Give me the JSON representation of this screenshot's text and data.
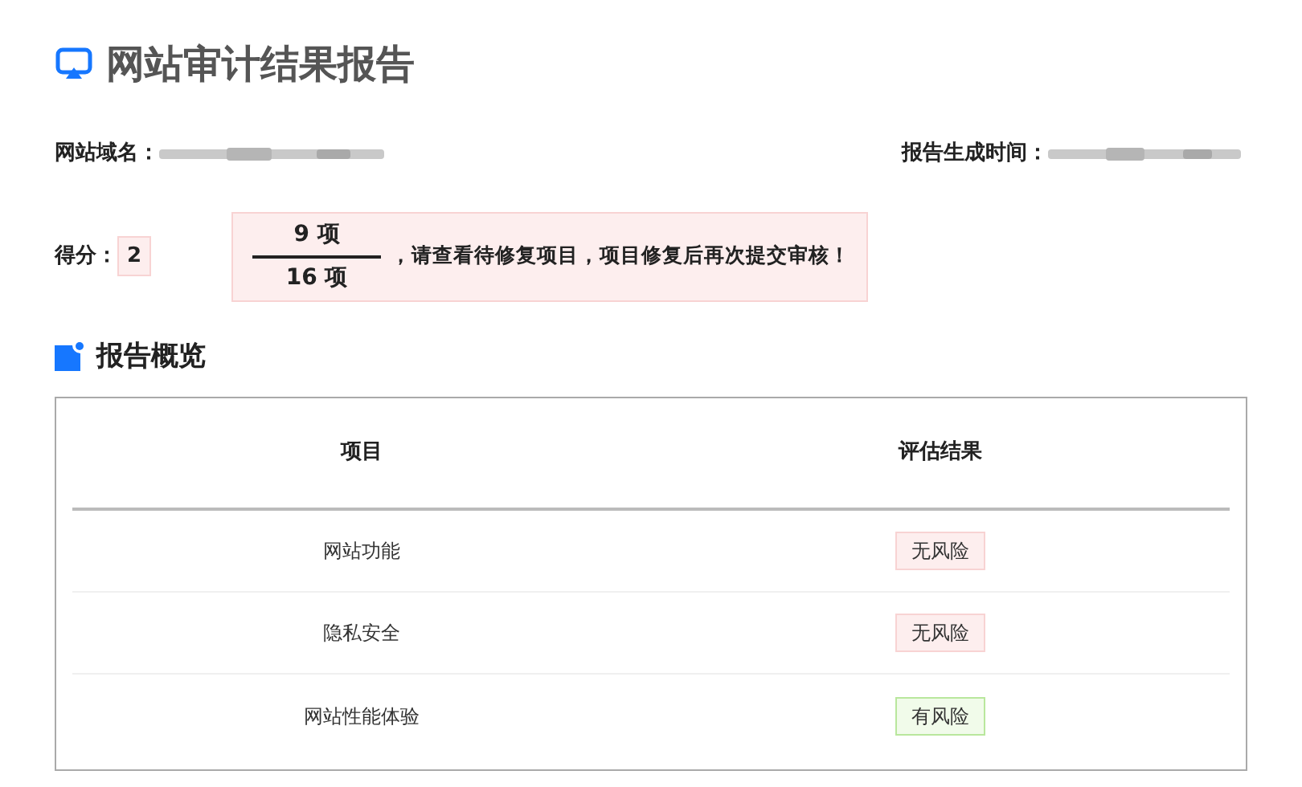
{
  "title": "网站审计结果报告",
  "domain": {
    "label": "网站域名："
  },
  "generated_time": {
    "label": "报告生成时间："
  },
  "score": {
    "label": "得分：",
    "value": "2"
  },
  "notice": {
    "numerator": "9 项",
    "denominator": "16 项",
    "message": "，请查看待修复项目，项目修复后再次提交审核！"
  },
  "section": {
    "title": "报告概览"
  },
  "table": {
    "columns": [
      "项目",
      "评估结果"
    ],
    "rows": [
      {
        "item": "网站功能",
        "result": "无风险",
        "kind": "safe"
      },
      {
        "item": "隐私安全",
        "result": "无风险",
        "kind": "safe"
      },
      {
        "item": "网站性能体验",
        "result": "有风险",
        "kind": "risk"
      }
    ]
  }
}
